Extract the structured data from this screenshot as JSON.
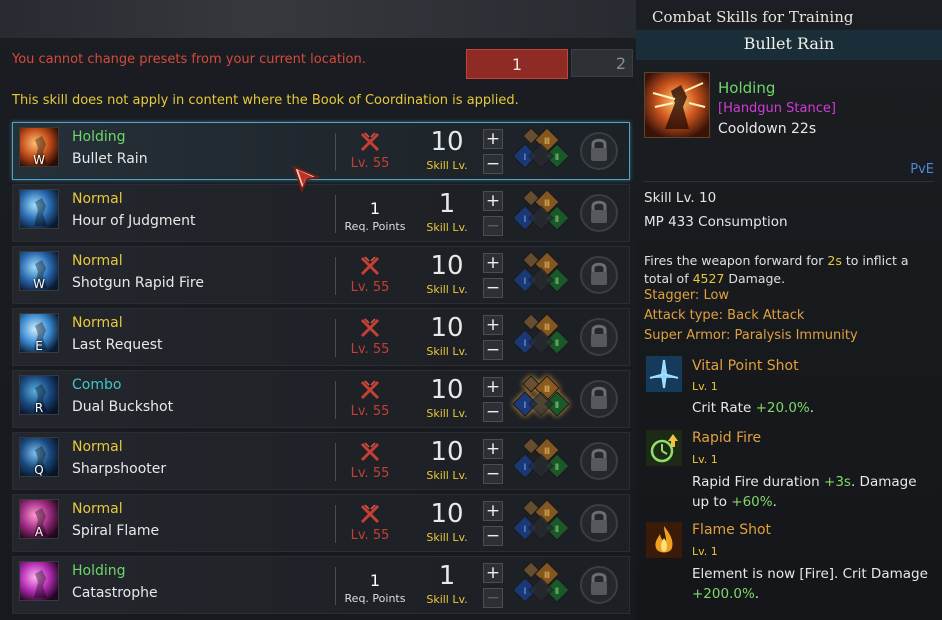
{
  "notices": {
    "preset_warning": "You cannot change presets from your current location.",
    "coordination_warning": "This skill does not apply in content where the Book of Coordination is applied."
  },
  "presets": [
    "1",
    "2"
  ],
  "skills": [
    {
      "type": "Holding",
      "name": "Bullet Rain",
      "key": "W",
      "locked": true,
      "lock_level": "Lv. 55",
      "skill_level": "10",
      "selected": true
    },
    {
      "type": "Normal",
      "name": "Hour of Judgment",
      "key": "",
      "locked": false,
      "req_points": "1",
      "req_label": "Req. Points",
      "skill_level": "1"
    },
    {
      "type": "Normal",
      "name": "Shotgun Rapid Fire",
      "key": "W",
      "locked": true,
      "lock_level": "Lv. 55",
      "skill_level": "10"
    },
    {
      "type": "Normal",
      "name": "Last Request",
      "key": "E",
      "locked": true,
      "lock_level": "Lv. 55",
      "skill_level": "10"
    },
    {
      "type": "Combo",
      "name": "Dual Buckshot",
      "key": "R",
      "locked": true,
      "lock_level": "Lv. 55",
      "skill_level": "10"
    },
    {
      "type": "Normal",
      "name": "Sharpshooter",
      "key": "Q",
      "locked": true,
      "lock_level": "Lv. 55",
      "skill_level": "10"
    },
    {
      "type": "Normal",
      "name": "Spiral Flame",
      "key": "A",
      "locked": true,
      "lock_level": "Lv. 55",
      "skill_level": "10"
    },
    {
      "type": "Holding",
      "name": "Catastrophe",
      "key": "",
      "locked": false,
      "req_points": "1",
      "req_label": "Req. Points",
      "skill_level": "1"
    }
  ],
  "skill_level_label": "Skill Lv.",
  "tooltip": {
    "header": "Combat Skills for Training",
    "skill_name": "Bullet Rain",
    "type": "Holding",
    "stance": "[Handgun Stance]",
    "cooldown": "Cooldown 22s",
    "mode": "PvE",
    "skill_level": "Skill Lv. 10",
    "mp": "MP 433 Consumption",
    "desc_a": "Fires the weapon forward for ",
    "desc_b": "2s",
    "desc_c": " to inflict a total of ",
    "desc_d": "4527",
    "desc_e": " Damage.",
    "stagger": "Stagger: Low",
    "attack_type": "Attack type: Back Attack",
    "super_armor": "Super Armor: Paralysis Immunity",
    "tripods": [
      {
        "name": "Vital Point Shot",
        "level": "Lv. 1",
        "desc_a": "Crit Rate ",
        "desc_b": "+20.0%",
        "desc_c": "."
      },
      {
        "name": "Rapid Fire",
        "level": "Lv. 1",
        "desc_a": "Rapid Fire duration ",
        "desc_b": "+3s",
        "desc_c": ". Damage up to ",
        "desc_d": "+60%",
        "desc_e": "."
      },
      {
        "name": "Flame Shot",
        "level": "Lv. 1",
        "desc_a": "Element is now [Fire]. Crit Damage ",
        "desc_b": "+200.0%",
        "desc_c": "."
      }
    ]
  }
}
